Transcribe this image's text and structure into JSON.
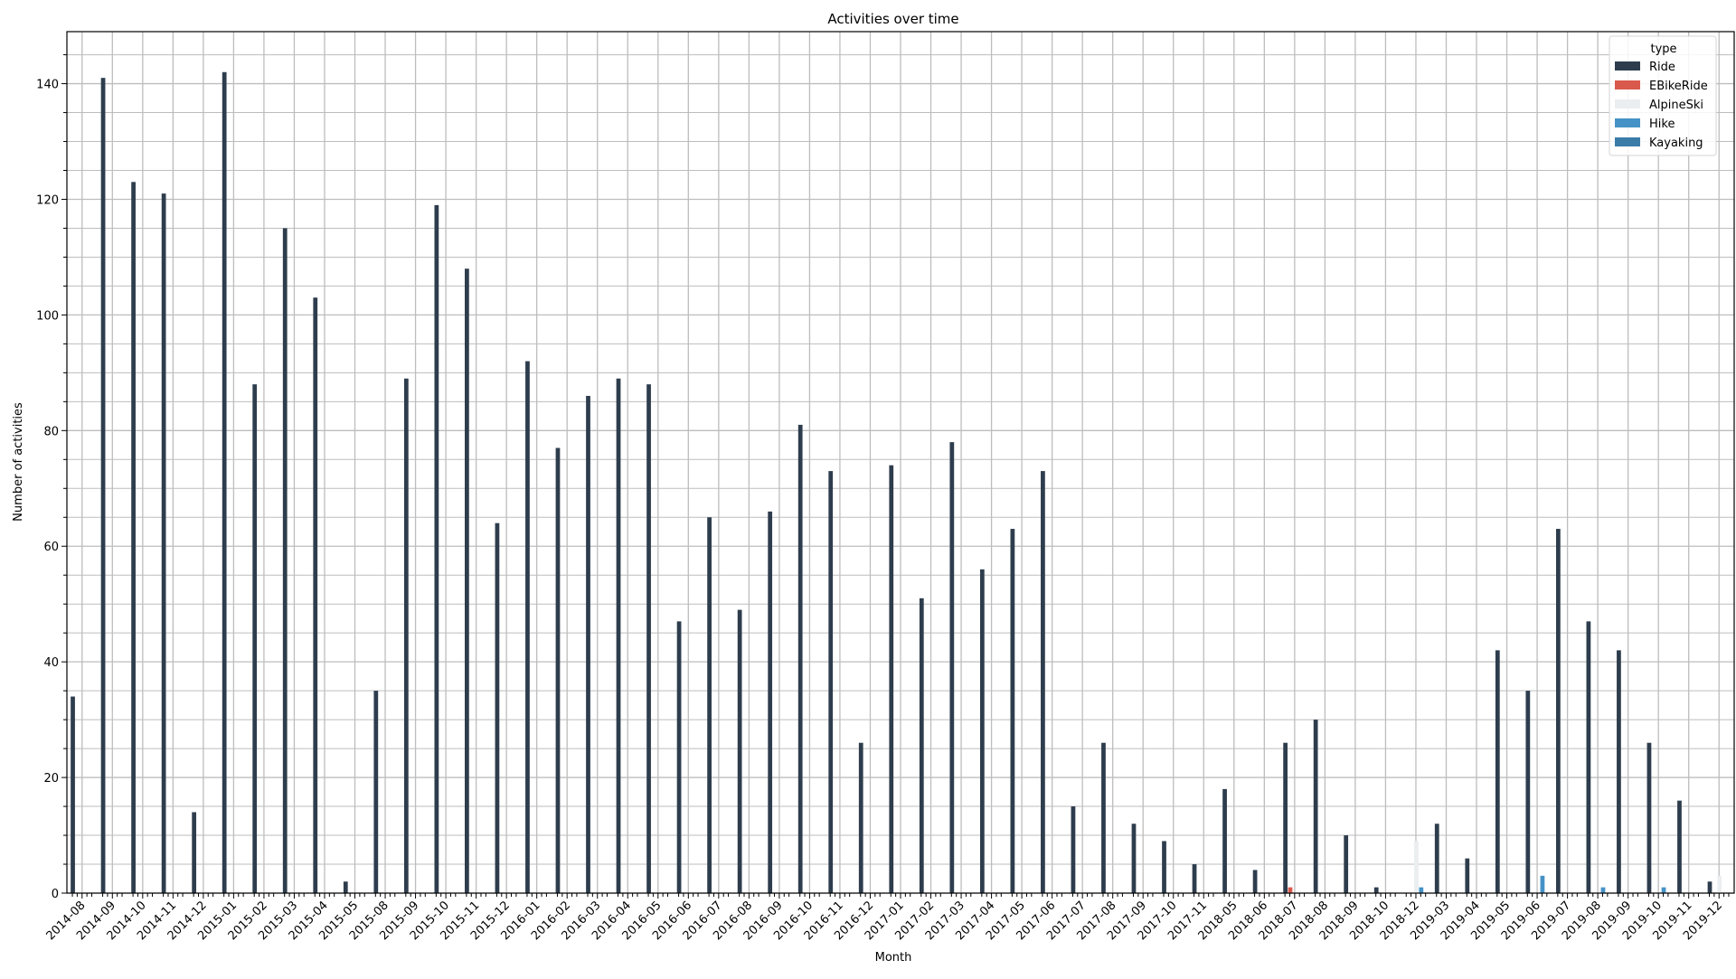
{
  "chart_data": {
    "type": "bar",
    "title": "Activities over time",
    "xlabel": "Month",
    "ylabel": "Number of activities",
    "ylim": [
      0,
      149
    ],
    "yticks": [
      0,
      20,
      40,
      60,
      80,
      100,
      120,
      140
    ],
    "y_minor_step": 5,
    "grid": true,
    "legend": {
      "title": "type",
      "placement": "top-right"
    },
    "categories": [
      "2014-08",
      "2014-09",
      "2014-10",
      "2014-11",
      "2014-12",
      "2015-01",
      "2015-02",
      "2015-03",
      "2015-04",
      "2015-05",
      "2015-08",
      "2015-09",
      "2015-10",
      "2015-11",
      "2015-12",
      "2016-01",
      "2016-02",
      "2016-03",
      "2016-04",
      "2016-05",
      "2016-06",
      "2016-07",
      "2016-08",
      "2016-09",
      "2016-10",
      "2016-11",
      "2016-12",
      "2017-01",
      "2017-02",
      "2017-03",
      "2017-04",
      "2017-05",
      "2017-06",
      "2017-07",
      "2017-08",
      "2017-09",
      "2017-10",
      "2017-11",
      "2018-05",
      "2018-06",
      "2018-07",
      "2018-08",
      "2018-09",
      "2018-10",
      "2018-12",
      "2019-03",
      "2019-04",
      "2019-05",
      "2019-06",
      "2019-07",
      "2019-08",
      "2019-09",
      "2019-10",
      "2019-11",
      "2019-12"
    ],
    "series": [
      {
        "name": "Ride",
        "color": "#2e3d4d",
        "values": [
          34,
          141,
          123,
          121,
          14,
          142,
          88,
          115,
          103,
          2,
          35,
          89,
          119,
          108,
          64,
          92,
          77,
          86,
          89,
          88,
          47,
          65,
          49,
          66,
          81,
          73,
          26,
          74,
          51,
          78,
          56,
          63,
          73,
          15,
          26,
          12,
          9,
          5,
          18,
          4,
          26,
          30,
          10,
          1,
          0,
          12,
          6,
          42,
          35,
          63,
          47,
          42,
          26,
          16,
          2
        ]
      },
      {
        "name": "EBikeRide",
        "color": "#d9594c",
        "values": [
          0,
          0,
          0,
          0,
          0,
          0,
          0,
          0,
          0,
          0,
          0,
          0,
          0,
          0,
          0,
          0,
          0,
          0,
          0,
          0,
          0,
          0,
          0,
          0,
          0,
          0,
          0,
          0,
          0,
          0,
          0,
          0,
          0,
          0,
          0,
          0,
          0,
          0,
          0,
          0,
          1,
          0,
          0,
          0,
          0,
          0,
          0,
          0,
          0,
          0,
          0,
          0,
          0,
          0,
          0
        ]
      },
      {
        "name": "AlpineSki",
        "color": "#ebeef0",
        "values": [
          0,
          0,
          0,
          0,
          0,
          0,
          0,
          0,
          0,
          0,
          0,
          0,
          0,
          0,
          0,
          0,
          0,
          0,
          0,
          0,
          0,
          0,
          0,
          0,
          0,
          0,
          0,
          0,
          0,
          0,
          0,
          0,
          0,
          0,
          0,
          0,
          0,
          0,
          0,
          0,
          0,
          0,
          0,
          0,
          9,
          0,
          0,
          0,
          0,
          0,
          0,
          0,
          0,
          0,
          3
        ]
      },
      {
        "name": "Hike",
        "color": "#4592c6",
        "values": [
          0,
          0,
          0,
          0,
          0,
          0,
          0,
          0,
          0,
          0,
          0,
          0,
          0,
          0,
          0,
          0,
          0,
          0,
          0,
          0,
          0,
          0,
          0,
          0,
          0,
          0,
          0,
          0,
          0,
          0,
          0,
          0,
          0,
          0,
          0,
          0,
          0,
          0,
          0,
          0,
          0,
          0,
          0,
          0,
          1,
          0,
          0,
          0,
          3,
          0,
          1,
          0,
          1,
          0,
          0
        ]
      },
      {
        "name": "Kayaking",
        "color": "#3a7ca8",
        "values": [
          0,
          0,
          0,
          0,
          0,
          0,
          0,
          0,
          0,
          0,
          0,
          0,
          0,
          0,
          0,
          0,
          0,
          0,
          0,
          0,
          0,
          0,
          0,
          0,
          0,
          0,
          0,
          0,
          0,
          0,
          0,
          0,
          0,
          0,
          0,
          0,
          0,
          0,
          0,
          0,
          0,
          0,
          0,
          0,
          0,
          0,
          0,
          0,
          0,
          0,
          0,
          0,
          0,
          0,
          0
        ]
      }
    ]
  }
}
